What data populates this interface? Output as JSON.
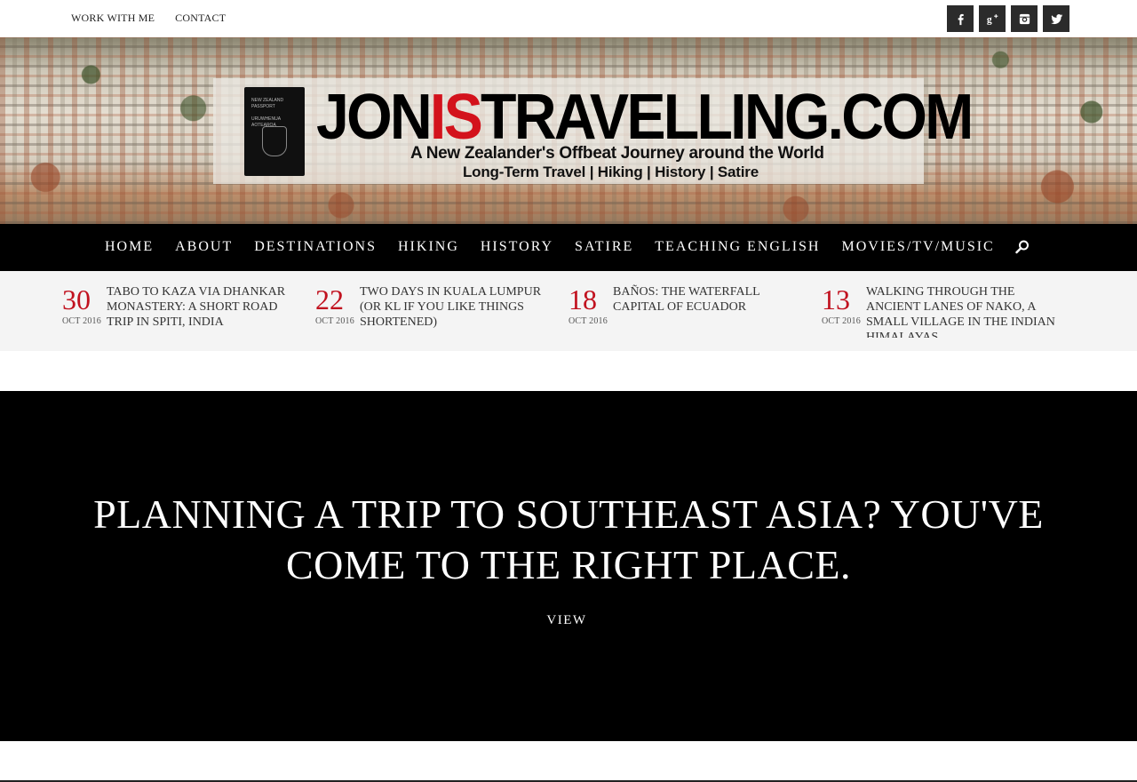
{
  "topbar": {
    "links": [
      "WORK WITH ME",
      "CONTACT"
    ],
    "social": [
      {
        "name": "facebook-icon",
        "glyph": "f"
      },
      {
        "name": "google-plus-icon",
        "glyph": "g+"
      },
      {
        "name": "instagram-icon",
        "glyph": ""
      },
      {
        "name": "twitter-icon",
        "glyph": ""
      }
    ]
  },
  "banner": {
    "title_part1": "JON",
    "title_part2": "IS",
    "title_part3": "TRAVELLING.COM",
    "tagline": "A New Zealander's Offbeat Journey around the World",
    "subtagline": "Long-Term Travel | Hiking | History | Satire",
    "passport_text": "NEW ZEALAND\nPASSPORT\nURUWHENUA\nAOTEAROA",
    "accent": "#d3121c"
  },
  "nav": {
    "items": [
      "HOME",
      "ABOUT",
      "DESTINATIONS",
      "HIKING",
      "HISTORY",
      "SATIRE",
      "TEACHING ENGLISH",
      "MOVIES/TV/MUSIC"
    ],
    "search_icon": "search-icon"
  },
  "recent_posts": [
    {
      "day": "30",
      "month": "OCT 2016",
      "title": "TABO TO KAZA VIA DHANKAR MONASTERY: A SHORT ROAD TRIP IN SPITI, INDIA"
    },
    {
      "day": "22",
      "month": "OCT 2016",
      "title": "TWO DAYS IN KUALA LUMPUR (OR KL IF YOU LIKE THINGS SHORTENED)"
    },
    {
      "day": "18",
      "month": "OCT 2016",
      "title": "BAÑOS: THE WATERFALL CAPITAL OF ECUADOR"
    },
    {
      "day": "13",
      "month": "OCT 2016",
      "title": "WALKING THROUGH THE ANCIENT LANES OF NAKO, A SMALL VILLAGE IN THE INDIAN HIMALAYAS"
    }
  ],
  "hero": {
    "heading": "PLANNING A TRIP TO SOUTHEAST ASIA? YOU'VE COME TO THE RIGHT PLACE.",
    "button": "VIEW"
  },
  "colors": {
    "date_red": "#c1121f",
    "nav_bg": "#000000",
    "strip_bg": "#f4f4f4"
  }
}
